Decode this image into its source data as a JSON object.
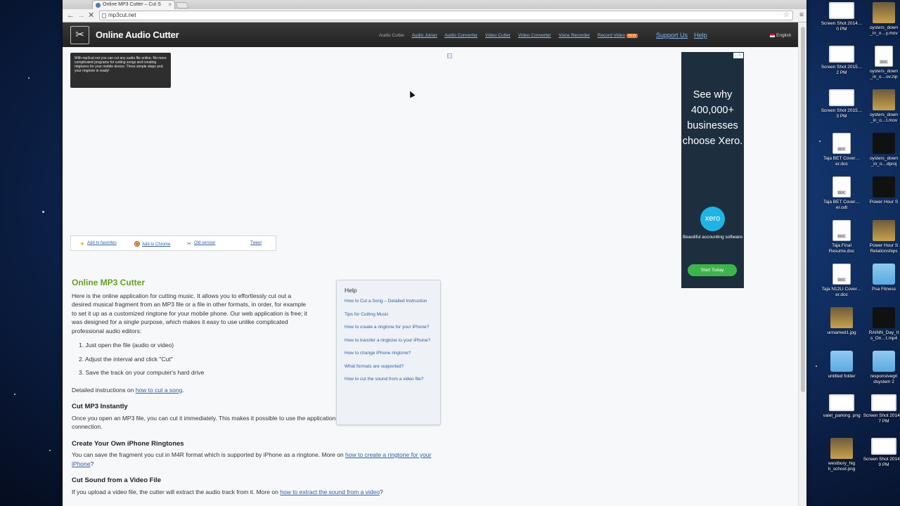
{
  "browser": {
    "tab_title": "Online MP3 Cutter – Cut S",
    "url": "mp3cut.net"
  },
  "site": {
    "title": "Online Audio Cutter",
    "nav": [
      "Audio Cutter",
      "Audio Joiner",
      "Audio Converter",
      "Video Cutter",
      "Video Converter",
      "Voice Recorder",
      "Record Video"
    ],
    "new_badge": "NEW",
    "support": "Support Us",
    "help": "Help",
    "language": "English",
    "intro_tooltip": "With mp3cut.net you can cut any audio file online. No more complicated programs for cutting songs and creating ringtones for your mobile device. Three simple steps and your ringtone is ready!",
    "share": {
      "favorites": "Add to favorites",
      "chrome": "Add to Chrome",
      "old": "Old version",
      "tweet": "Tweet"
    }
  },
  "content": {
    "heading": "Online MP3 Cutter",
    "intro": "Here is the online application for cutting music. It allows you to effortlessly cut out a desired musical fragment from an MP3 file or a file in other formats, in order, for example to set it up as a customized ringtone for your mobile phone. Our web application is free; it was designed for a single purpose, which makes it easy to use unlike complicated professional audio editors:",
    "steps": [
      "1.  Just open the file (audio or video)",
      "2.  Adjust the interval and click \"Cut\"",
      "3.  Save the track on your computer's hard drive"
    ],
    "detailed_prefix": "Detailed instructions on ",
    "detailed_link": "how to cut a song",
    "detailed_suffix": ".",
    "s1_title": "Cut MP3 Instantly",
    "s1_text": "Once you open an MP3 file, you can cut it immediately. This makes it possible to use the application even having a slow Internet connection.",
    "s2_title": "Create Your Own iPhone Ringtones",
    "s2_prefix": "You can save the fragment you cut in M4R format which is supported by iPhone as a ringtone. More on ",
    "s2_link": "how to create a ringtone for your iPhone",
    "s2_suffix": "?",
    "s3_title": "Cut Sound from a Video File",
    "s3_prefix": "If you upload a video file, the cutter will extract the audio track from it. More on ",
    "s3_link": "how to extract the sound from a video",
    "s3_suffix": "?"
  },
  "help_box": {
    "title": "Help",
    "links": [
      "How to Cut a Song – Detailed Instruction",
      "Tips for Cutting Music",
      "How to create a ringtone for your iPhone?",
      "How to transfer a ringtone to your iPhone?",
      "How to change iPhone ringtone?",
      "What formats are supported?",
      "How to cut the sound from a video file?"
    ]
  },
  "ad": {
    "headline": "See why 400,000+ businesses choose Xero.",
    "logo": "xero",
    "sub": "Beautiful accounting software",
    "cta": "Start Today"
  },
  "desktop": {
    "icons": [
      {
        "label": "Screen Shot 2014…0 PM",
        "kind": "shot"
      },
      {
        "label": "oysters_down _in_o…y.mov",
        "kind": "photo"
      },
      {
        "label": "Screen Shot 2015…2 PM",
        "kind": "shot"
      },
      {
        "label": "oysters_down _in_o…ov.zip",
        "kind": "doc"
      },
      {
        "label": "Screen Shot 2015…3 PM",
        "kind": "shot"
      },
      {
        "label": "oysters_down _in_o…t.mov",
        "kind": "photo"
      },
      {
        "label": "Taja BET Cover…er.doc",
        "kind": "doc"
      },
      {
        "label": "oysters_down _in_o…dproj",
        "kind": "video"
      },
      {
        "label": "Taja BET Cover…er.odt",
        "kind": "doc"
      },
      {
        "label": "Power Hour S",
        "kind": "video"
      },
      {
        "label": "Taja Final Resume.doc",
        "kind": "doc"
      },
      {
        "label": "Power Hour S Relationships",
        "kind": "photo"
      },
      {
        "label": "Taja N12LI Cover…er.doc",
        "kind": "doc"
      },
      {
        "label": "Psa Fitness",
        "kind": "folder"
      },
      {
        "label": "unnamed1.jpg",
        "kind": "photo"
      },
      {
        "label": "RAINN_Day_It s_On…t.mp4",
        "kind": "video"
      },
      {
        "label": "untitled folder",
        "kind": "folder"
      },
      {
        "label": "responsivegri dsystem 2",
        "kind": "folder"
      },
      {
        "label": "valet_parking. png",
        "kind": "shot"
      },
      {
        "label": "Screen Shot 2014…7 PM",
        "kind": "shot"
      },
      {
        "label": "westbury_hig h_school.png",
        "kind": "photo"
      },
      {
        "label": "Screen Shot 2014…9 PM",
        "kind": "shot"
      }
    ]
  }
}
